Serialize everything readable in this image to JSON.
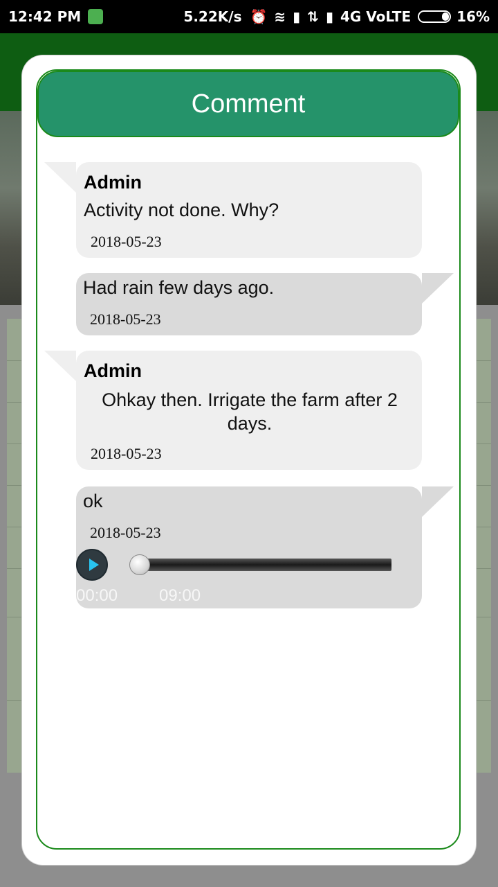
{
  "status_bar": {
    "time": "12:42 PM",
    "speed": "5.22K/s",
    "network": "4G VoLTE",
    "battery": "16%"
  },
  "dialog": {
    "title": "Comment",
    "colors": {
      "header": "#25936a",
      "border": "#1b8a1b"
    }
  },
  "messages": [
    {
      "author": "Admin",
      "text": "Activity not done. Why?",
      "date": "2018-05-23",
      "direction": "incoming"
    },
    {
      "text": "Had rain few days ago.",
      "date": "2018-05-23",
      "direction": "outgoing"
    },
    {
      "author": "Admin",
      "text": "Ohkay then. Irrigate the farm after 2 days.",
      "date": "2018-05-23",
      "direction": "incoming"
    },
    {
      "text": "ok",
      "date": "2018-05-23",
      "direction": "outgoing",
      "audio": {
        "elapsed": "00:00",
        "duration": "09:00",
        "progress": 0
      }
    }
  ]
}
